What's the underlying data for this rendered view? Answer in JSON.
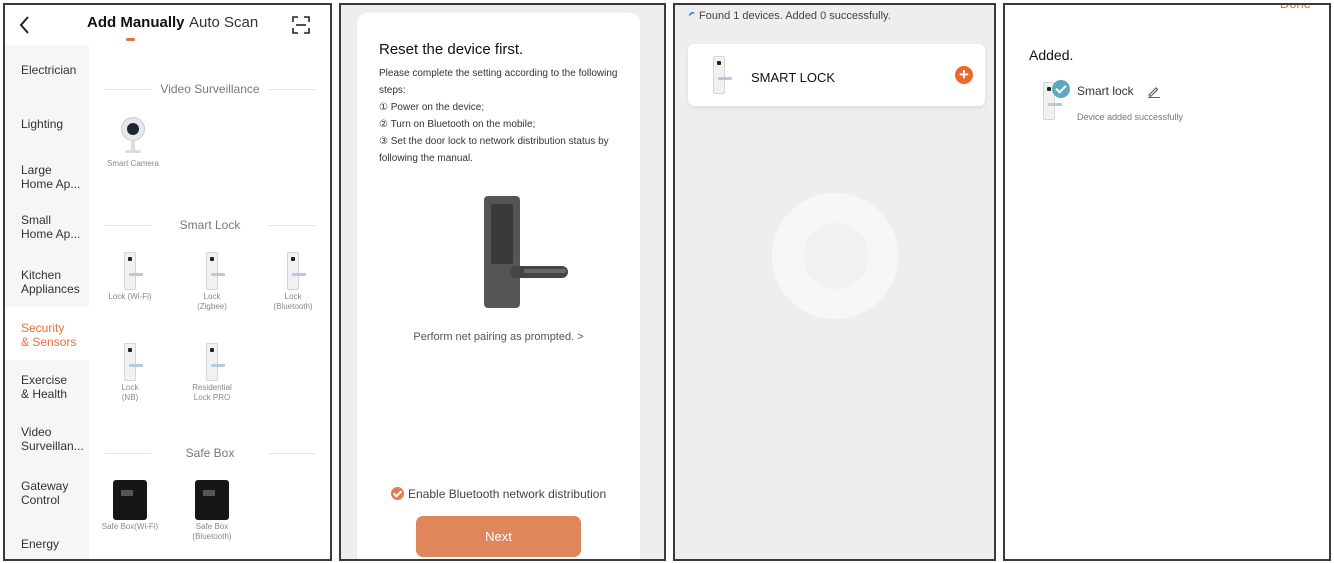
{
  "screen1": {
    "tabs": {
      "manual": "Add Manually",
      "auto": "Auto Scan"
    },
    "sidebar": [
      {
        "label": "Electrician",
        "active": false
      },
      {
        "label": "Lighting",
        "active": false
      },
      {
        "label": "Large\nHome Ap...",
        "active": false
      },
      {
        "label": "Small\nHome Ap...",
        "active": false
      },
      {
        "label": "Kitchen\nAppliances",
        "active": false
      },
      {
        "label": "Security\n& Sensors",
        "active": true
      },
      {
        "label": "Exercise\n& Health",
        "active": false
      },
      {
        "label": "Video\nSurveillan...",
        "active": false
      },
      {
        "label": "Gateway\nControl",
        "active": false
      },
      {
        "label": "Energy",
        "active": false
      }
    ],
    "sections": {
      "video": "Video Surveillance",
      "lock": "Smart Lock",
      "safe": "Safe Box"
    },
    "devices": {
      "camera": "Smart Camera",
      "lock_wifi": "Lock (Wi-Fi)",
      "lock_zigbee_1": "Lock",
      "lock_zigbee_2": "(Zigbee)",
      "lock_bt_1": "Lock",
      "lock_bt_2": "(Bluetooth)",
      "lock_nb_1": "Lock",
      "lock_nb_2": "(NB)",
      "lock_res_1": "Residential",
      "lock_res_2": "Lock PRO",
      "safe_wifi": "Safe Box(Wi-Fi)",
      "safe_bt_1": "Safe Box",
      "safe_bt_2": "(Bluetooth)"
    }
  },
  "screen2": {
    "title": "Reset the device first.",
    "intro": "Please complete the setting according to the following steps:",
    "steps": [
      "① Power on the device;",
      "② Turn on Bluetooth on the mobile;",
      "③ Set the door lock to network distribution status by following the manual."
    ],
    "pairing_link": "Perform net pairing as prompted. >",
    "bluetooth_option": "Enable Bluetooth network distribution",
    "next_button": "Next"
  },
  "screen3": {
    "status": "Found 1 devices. Added 0 successfully.",
    "device_name": "SMART LOCK",
    "add_symbol": "+"
  },
  "screen4": {
    "done": "Done",
    "title": "Added.",
    "device_name": "Smart lock",
    "status": "Device added successfully"
  },
  "colors": {
    "accent": "#e8703f",
    "button": "#df865b",
    "add": "#ea6a2c",
    "success": "#5ba8c0"
  }
}
